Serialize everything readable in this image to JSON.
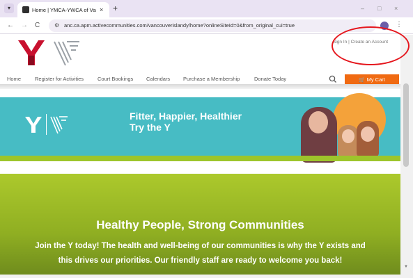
{
  "browser": {
    "tab": {
      "title": "Home | YMCA-YWCA of Vancou",
      "close": "×"
    },
    "new_tab": "+",
    "window": {
      "minimize": "–",
      "maximize": "□",
      "close": "×"
    },
    "nav": {
      "back": "←",
      "forward": "→",
      "reload": "C"
    },
    "url": "anc.ca.apm.activecommunities.com/vancouverislandy/home?onlineSiteId=0&from_original_cui=true",
    "menu": "⋮"
  },
  "header": {
    "sign_in": "Sign In",
    "separator": "|",
    "create_account": "Create an Account"
  },
  "nav_items": [
    {
      "label": "Home"
    },
    {
      "label": "Register for Activities"
    },
    {
      "label": "Court Bookings"
    },
    {
      "label": "Calendars"
    },
    {
      "label": "Purchase a Membership"
    },
    {
      "label": "Donate Today"
    }
  ],
  "cart_label": "My Cart",
  "hero": {
    "line1": "Fitter, Happier, Healthier",
    "line2": "Try the Y"
  },
  "section": {
    "heading": "Healthy People, Strong Communities",
    "body_line1": "Join the Y today! The health and well-being of our communities is why the Y exists and",
    "body_line2": "this drives our priorities. Our friendly staff are ready to welcome you back!"
  },
  "colors": {
    "brand_red": "#c8102e",
    "teal": "#47bcc4",
    "lime": "#9dc52b",
    "cart_orange": "#f06a12",
    "annotation_red": "#e5161d"
  }
}
